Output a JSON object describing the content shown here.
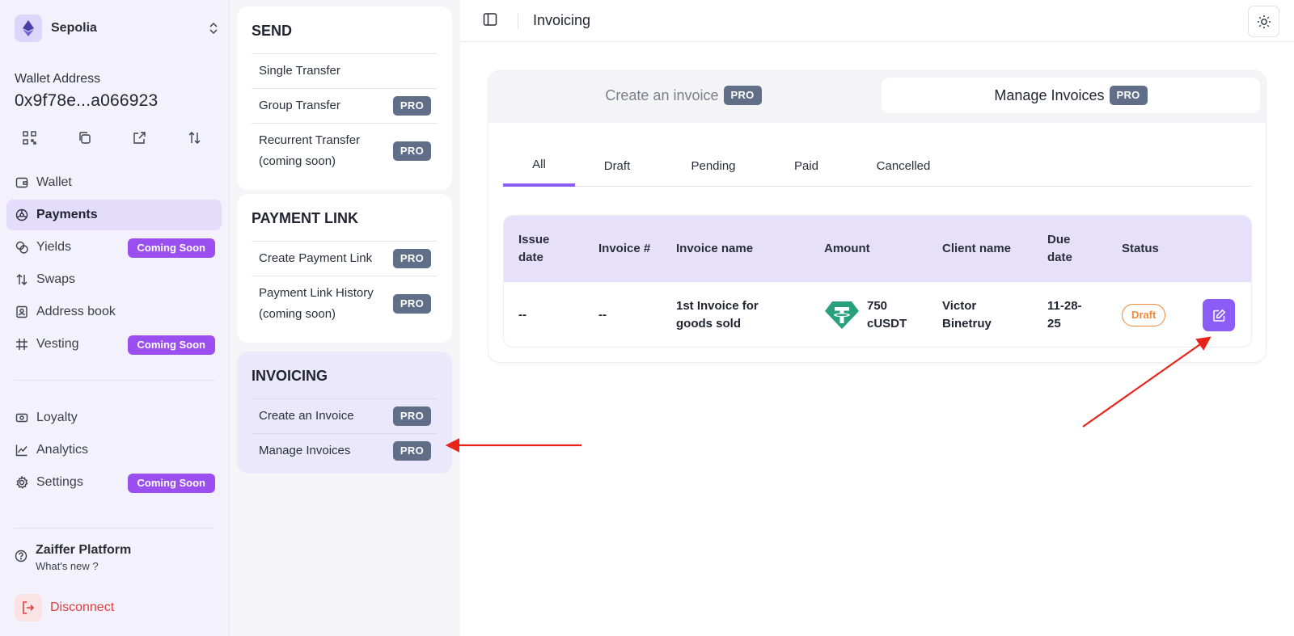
{
  "network": {
    "name": "Sepolia",
    "icon": "ethereum-icon"
  },
  "wallet": {
    "label": "Wallet Address",
    "address": "0x9f78e...a066923",
    "actions": [
      "qr-code-icon",
      "copy-icon",
      "external-link-icon",
      "swap-arrows-icon"
    ]
  },
  "sidebar": {
    "items": [
      {
        "label": "Wallet",
        "icon": "wallet-icon",
        "badge": ""
      },
      {
        "label": "Payments",
        "icon": "payments-icon",
        "badge": ""
      },
      {
        "label": "Yields",
        "icon": "yields-icon",
        "badge": "Coming Soon"
      },
      {
        "label": "Swaps",
        "icon": "swaps-icon",
        "badge": ""
      },
      {
        "label": "Address book",
        "icon": "address-book-icon",
        "badge": ""
      },
      {
        "label": "Vesting",
        "icon": "vesting-icon",
        "badge": "Coming Soon"
      }
    ],
    "items2": [
      {
        "label": "Loyalty",
        "icon": "loyalty-icon",
        "badge": ""
      },
      {
        "label": "Analytics",
        "icon": "analytics-icon",
        "badge": ""
      },
      {
        "label": "Settings",
        "icon": "settings-icon",
        "badge": "Coming Soon"
      }
    ],
    "platform": {
      "title": "Zaiffer Platform",
      "subtitle": "What's new ?"
    },
    "disconnect": "Disconnect"
  },
  "menu": {
    "send": {
      "title": "SEND",
      "items": [
        {
          "label": "Single Transfer",
          "badge": ""
        },
        {
          "label": "Group Transfer",
          "badge": "PRO"
        },
        {
          "label": "Recurrent Transfer (coming soon)",
          "badge": "PRO"
        }
      ]
    },
    "payment_link": {
      "title": "PAYMENT LINK",
      "items": [
        {
          "label": "Create Payment Link",
          "badge": "PRO"
        },
        {
          "label": "Payment Link History (coming soon)",
          "badge": "PRO"
        }
      ]
    },
    "invoicing": {
      "title": "INVOICING",
      "items": [
        {
          "label": "Create an Invoice",
          "badge": "PRO"
        },
        {
          "label": "Manage Invoices",
          "badge": "PRO"
        }
      ]
    }
  },
  "topbar": {
    "title": "Invoicing"
  },
  "panel": {
    "tabs": [
      {
        "label": "Create an invoice",
        "badge": "PRO"
      },
      {
        "label": "Manage Invoices",
        "badge": "PRO"
      }
    ],
    "status_tabs": [
      "All",
      "Draft",
      "Pending",
      "Paid",
      "Cancelled"
    ],
    "table": {
      "headers": [
        "Issue date",
        "Invoice #",
        "Invoice name",
        "Amount",
        "Client name",
        "Due date",
        "Status"
      ],
      "rows": [
        {
          "issue_date": "--",
          "invoice_no": "--",
          "invoice_name": "1st Invoice for goods sold",
          "amount": "750 cUSDT",
          "token_icon": "tether-icon",
          "client": "Victor Binetruy",
          "due_date": "11-28-25",
          "status": "Draft"
        }
      ]
    }
  },
  "colors": {
    "accent": "#8b5cf6",
    "coming_soon": "#9b4ff0",
    "pro": "#616e88",
    "draft": "#f08a3c",
    "disconnect": "#e03e3e",
    "annotation_arrow": "#e8231a"
  }
}
